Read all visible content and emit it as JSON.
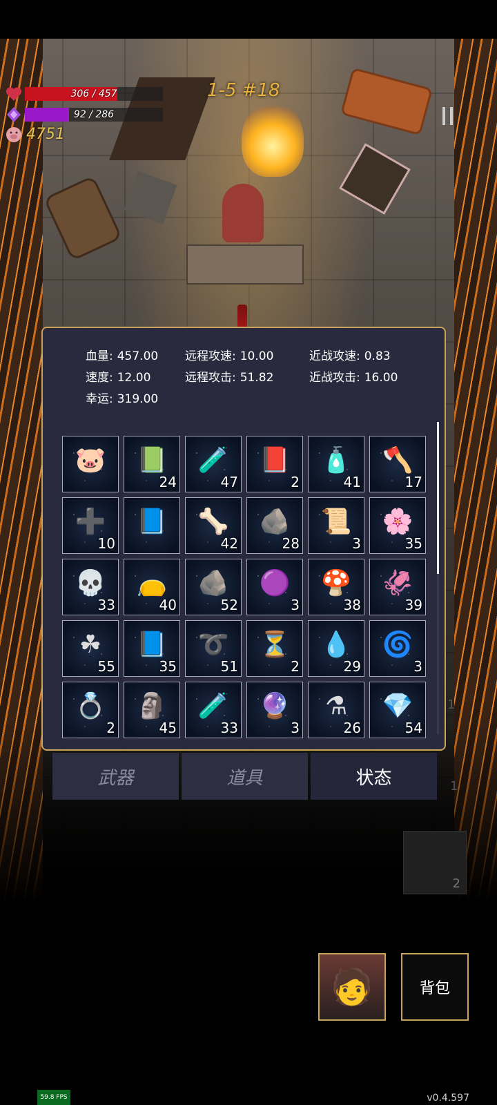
{
  "hud": {
    "hp_text": "306 / 457",
    "hp_ratio": 0.67,
    "mp_text": "92 / 286",
    "mp_ratio": 0.32,
    "gold": "4751",
    "level": "1-5 #18",
    "colors": {
      "hp": "#c8121e",
      "mp": "#9a18c8",
      "gold": "#e6c25a",
      "panel_border": "#c9a35a"
    }
  },
  "stats": {
    "hp_label": "血量:",
    "hp_value": "457.00",
    "ranged_speed_label": "远程攻速:",
    "ranged_speed_value": "10.00",
    "melee_speed_label": "近战攻速:",
    "melee_speed_value": "0.83",
    "speed_label": "速度:",
    "speed_value": "12.00",
    "ranged_attack_label": "远程攻击:",
    "ranged_attack_value": "51.82",
    "melee_attack_label": "近战攻击:",
    "melee_attack_value": "16.00",
    "luck_label": "幸运:",
    "luck_value": "319.00"
  },
  "items": [
    {
      "icon": "piggy-bank-icon",
      "glyph": "🐷",
      "count": ""
    },
    {
      "icon": "green-book-icon",
      "glyph": "📗",
      "count": "24"
    },
    {
      "icon": "green-potion-icon",
      "glyph": "🧪",
      "count": "47"
    },
    {
      "icon": "red-book-icon",
      "glyph": "📕",
      "count": "2"
    },
    {
      "icon": "vial-icon",
      "glyph": "🧴",
      "count": "41"
    },
    {
      "icon": "axe-icon",
      "glyph": "🪓",
      "count": "17"
    },
    {
      "icon": "medkit-icon",
      "glyph": "➕",
      "count": "10"
    },
    {
      "icon": "blue-book-icon",
      "glyph": "📘",
      "count": ""
    },
    {
      "icon": "horn-icon",
      "glyph": "🦴",
      "count": "42"
    },
    {
      "icon": "ore-icon",
      "glyph": "🪨",
      "count": "28"
    },
    {
      "icon": "scroll-icon",
      "glyph": "📜",
      "count": "3"
    },
    {
      "icon": "flowers-icon",
      "glyph": "🌸",
      "count": "35"
    },
    {
      "icon": "skull-icon",
      "glyph": "💀",
      "count": "33"
    },
    {
      "icon": "sack-icon",
      "glyph": "👝",
      "count": "40"
    },
    {
      "icon": "rocks-icon",
      "glyph": "🪨",
      "count": "52"
    },
    {
      "icon": "slime-icon",
      "glyph": "🟣",
      "count": "3"
    },
    {
      "icon": "mushroom-icon",
      "glyph": "🍄",
      "count": "38"
    },
    {
      "icon": "squid-icon",
      "glyph": "🦑",
      "count": "39"
    },
    {
      "icon": "clover-icon",
      "glyph": "☘",
      "count": "55"
    },
    {
      "icon": "cyan-book-icon",
      "glyph": "📘",
      "count": "35"
    },
    {
      "icon": "thorn-crown-icon",
      "glyph": "➰",
      "count": "51"
    },
    {
      "icon": "hourglass-rune-icon",
      "glyph": "⏳",
      "count": "2"
    },
    {
      "icon": "water-drop-icon",
      "glyph": "💧",
      "count": "29"
    },
    {
      "icon": "spiral-rune-icon",
      "glyph": "🌀",
      "count": "3"
    },
    {
      "icon": "ring-icon",
      "glyph": "💍",
      "count": "2"
    },
    {
      "icon": "statue-icon",
      "glyph": "🗿",
      "count": "45"
    },
    {
      "icon": "blue-potion-icon",
      "glyph": "🧪",
      "count": "33"
    },
    {
      "icon": "rainbow-orb-icon",
      "glyph": "🔮",
      "count": "3"
    },
    {
      "icon": "flask-icon",
      "glyph": "⚗",
      "count": "26"
    },
    {
      "icon": "crystal-rock-icon",
      "glyph": "💎",
      "count": "54"
    }
  ],
  "tabs": {
    "weapons": "武器",
    "items": "道具",
    "status": "状态"
  },
  "side": {
    "count_a": "1",
    "count_b": "1",
    "statue_count": "2"
  },
  "bag_label": "背包",
  "fps": "59.8 FPS",
  "version": "v0.4.597"
}
